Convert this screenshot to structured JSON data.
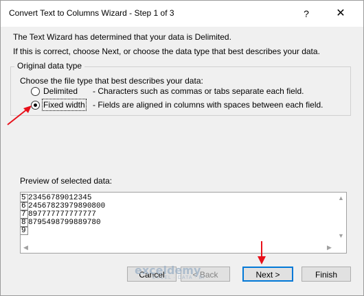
{
  "window": {
    "title": "Convert Text to Columns Wizard - Step 1 of 3",
    "help_label": "?",
    "close_label": "✕"
  },
  "intro": {
    "line1": "The Text Wizard has determined that your data is Delimited.",
    "line2": "If this is correct, choose Next, or choose the data type that best describes your data."
  },
  "original_data_type": {
    "legend": "Original data type",
    "prompt": "Choose the file type that best describes your data:",
    "options": [
      {
        "label": "Delimited",
        "description": "- Characters such as commas or tabs separate each field.",
        "selected": false
      },
      {
        "label": "Fixed width",
        "description": "- Fields are aligned in columns with spaces between each field.",
        "selected": true
      }
    ]
  },
  "preview": {
    "label": "Preview of selected data:",
    "rows": [
      {
        "num": "5",
        "text": "23456789012345"
      },
      {
        "num": "6",
        "text": "24567823979890800"
      },
      {
        "num": "7",
        "text": "897777777777777"
      },
      {
        "num": "8",
        "text": "8795498799889780"
      },
      {
        "num": "9",
        "text": ""
      }
    ]
  },
  "buttons": {
    "cancel": "Cancel",
    "back": "< Back",
    "next": "Next >",
    "finish": "Finish"
  },
  "watermark": {
    "logo": "exceldemy",
    "tagline": "EXCEL · DATA · BI"
  },
  "colors": {
    "annotation_arrow": "#e8101a",
    "default_button_border": "#0078d7"
  }
}
